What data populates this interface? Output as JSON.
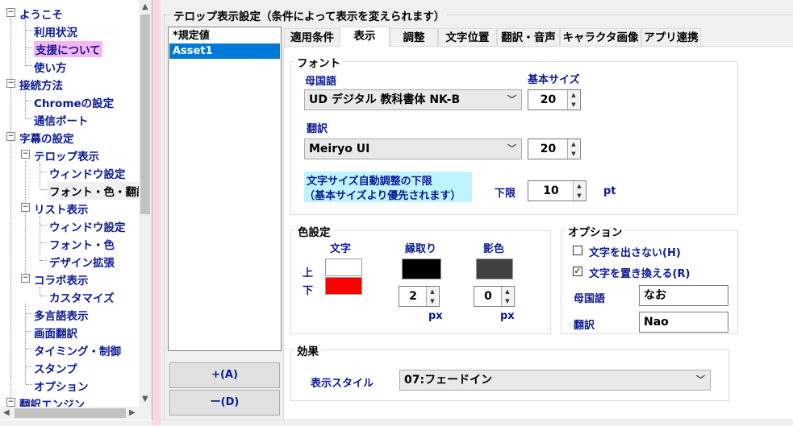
{
  "tree": {
    "items": [
      {
        "label": "ようこそ"
      },
      {
        "label": "利用状況"
      },
      {
        "label": "支援について"
      },
      {
        "label": "使い方"
      },
      {
        "label": "接続方法"
      },
      {
        "label": "Chromeの設定"
      },
      {
        "label": "通信ポート"
      },
      {
        "label": "字幕の設定"
      },
      {
        "label": "テロップ表示"
      },
      {
        "label": "ウィンドウ設定"
      },
      {
        "label": "フォント・色・翻訳"
      },
      {
        "label": "リスト表示"
      },
      {
        "label": "ウィンドウ設定"
      },
      {
        "label": "フォント・色"
      },
      {
        "label": "デザイン拡張"
      },
      {
        "label": "コラボ表示"
      },
      {
        "label": "カスタマイズ"
      },
      {
        "label": "多言語表示"
      },
      {
        "label": "画面翻訳"
      },
      {
        "label": "タイミング・制御"
      },
      {
        "label": "スタンプ"
      },
      {
        "label": "オプション"
      },
      {
        "label": "翻訳エンジン"
      }
    ]
  },
  "main": {
    "title": "テロップ表示設定（条件によって表示を変えられます）",
    "presets": [
      "*規定値",
      "Asset1"
    ],
    "add_label": "+(A)",
    "delete_label": "ー(D)"
  },
  "tabs": [
    "適用条件",
    "表示",
    "調整",
    "文字位置",
    "翻訳・音声",
    "キャラクタ画像",
    "アプリ連携"
  ],
  "font": {
    "group_label": "フォント",
    "native_label": "母国語",
    "base_size_label": "基本サイズ",
    "native_font": "UD デジタル 教科書体 NK-B",
    "native_size": "20",
    "translation_label": "翻訳",
    "translation_font": "Meiryo UI",
    "translation_size": "20",
    "auto_adjust_line1": "文字サイズ自動調整の下限",
    "auto_adjust_line2": "（基本サイズより優先されます）",
    "lower_limit_label": "下限",
    "lower_limit_value": "10",
    "unit": "pt"
  },
  "colors": {
    "group_label": "色設定",
    "text_label": "文字",
    "outline_label": "縁取り",
    "shadow_label": "影色",
    "upper_label": "上",
    "lower_label": "下",
    "text_upper_color": "#ffffff",
    "text_lower_color": "#ff0000",
    "outline_color": "#000000",
    "shadow_color": "#404040",
    "outline_width": "2",
    "shadow_width": "0",
    "unit": "px"
  },
  "options": {
    "group_label": "オプション",
    "hide_text_label": "文字を出さない(H)",
    "hide_text_checked": false,
    "replace_text_label": "文字を置き換える(R)",
    "replace_text_checked": true,
    "native_label": "母国語",
    "native_value": "なお",
    "translation_label": "翻訳",
    "translation_value": "Nao"
  },
  "effect": {
    "group_label": "効果",
    "style_label": "表示スタイル",
    "style_value": "07:フェードイン"
  }
}
